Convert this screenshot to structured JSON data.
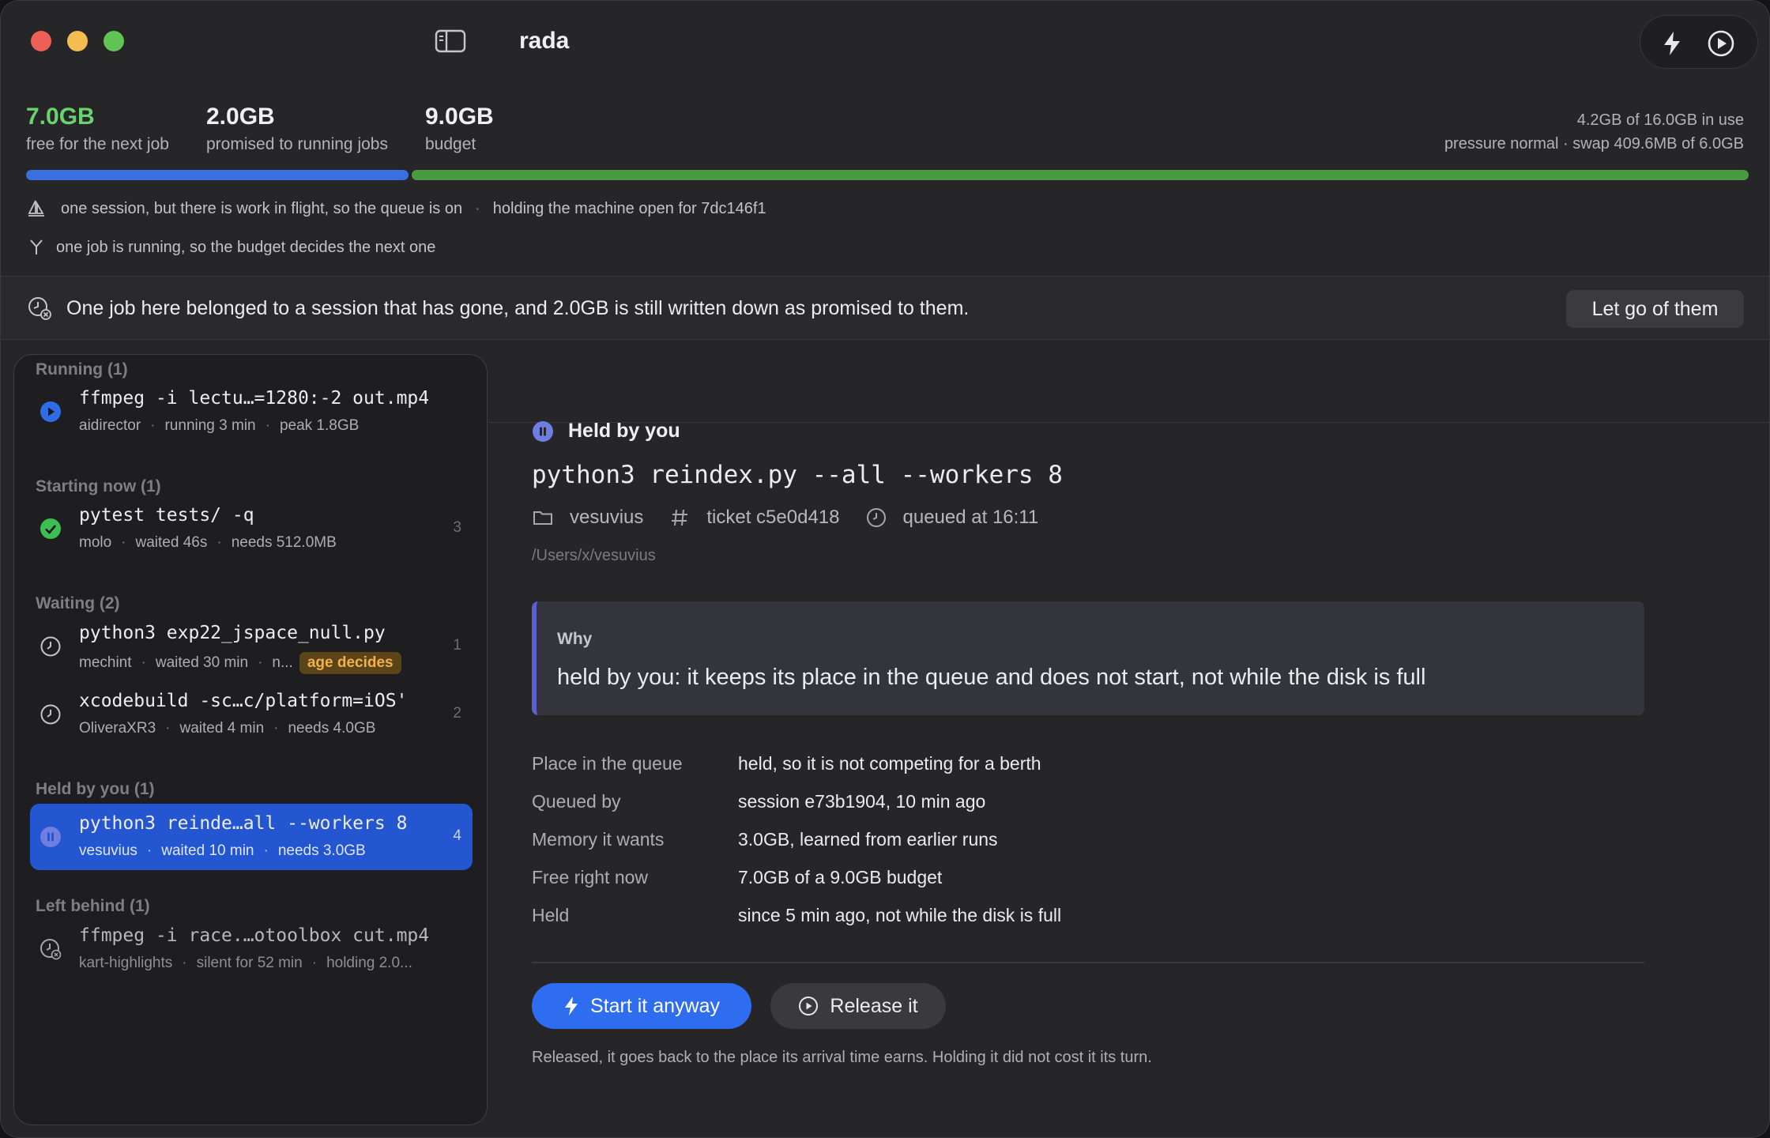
{
  "app": {
    "title": "rada"
  },
  "memory": {
    "free_value": "7.0GB",
    "free_label": "free for the next job",
    "promised_value": "2.0GB",
    "promised_label": "promised to running jobs",
    "budget_value": "9.0GB",
    "budget_label": "budget",
    "in_use": "4.2GB of 16.0GB in use",
    "pressure": "pressure normal · swap 409.6MB of 6.0GB",
    "bar_colors": {
      "promised": "#3a6fe0",
      "free": "#4a9a42"
    }
  },
  "info": {
    "queue_status": "one session, but there is work in flight, so the queue is on",
    "holding": "holding the machine open for 7dc146f1",
    "budget_rule": "one job is running, so the budget decides the next one"
  },
  "alert": {
    "text": "One job here belonged to a session that has gone, and 2.0GB is still written down as promised to them.",
    "button": "Let go of them"
  },
  "sidebar": {
    "groups": {
      "running": "Running (1)",
      "starting": "Starting now (1)",
      "waiting": "Waiting (2)",
      "held": "Held by you (1)",
      "left": "Left behind (1)"
    },
    "jobs": [
      {
        "cmd": "ffmpeg -i lectu…=1280:-2 out.mp4",
        "owner": "aidirector",
        "time": "running 3 min",
        "mem": "peak 1.8GB",
        "num": "",
        "icon": "play-circle-icon"
      },
      {
        "cmd": "pytest tests/ -q",
        "owner": "molo",
        "time": "waited 46s",
        "mem": "needs 512.0MB",
        "num": "3",
        "icon": "check-circle-icon"
      },
      {
        "cmd": "python3 exp22_jspace_null.py",
        "owner": "mechint",
        "time": "waited 30 min",
        "mem": "n...",
        "badge": "age decides",
        "num": "1",
        "icon": "clock-icon"
      },
      {
        "cmd": "xcodebuild -sc…c/platform=iOS'",
        "owner": "OliveraXR3",
        "time": "waited 4 min",
        "mem": "needs 4.0GB",
        "num": "2",
        "icon": "clock-icon"
      },
      {
        "cmd": "python3 reinde…all --workers 8",
        "owner": "vesuvius",
        "time": "waited 10 min",
        "mem": "needs 3.0GB",
        "num": "4",
        "icon": "pause-circle-icon"
      },
      {
        "cmd": "ffmpeg -i race.…otoolbox cut.mp4",
        "owner": "kart-highlights",
        "time": "silent for 52 min",
        "mem": "holding 2.0...",
        "num": "",
        "icon": "clock-x-icon"
      }
    ]
  },
  "detail": {
    "status": "Held by you",
    "command": "python3 reindex.py --all --workers 8",
    "project": "vesuvius",
    "ticket": "ticket c5e0d418",
    "queued": "queued at 16:11",
    "path": "/Users/x/vesuvius",
    "why_title": "Why",
    "why_text": "held by you: it keeps its place in the queue and does not start, not while the disk is full",
    "fields": [
      {
        "key": "Place in the queue",
        "value": "held, so it is not competing for a berth"
      },
      {
        "key": "Queued by",
        "value": "session e73b1904, 10 min ago"
      },
      {
        "key": "Memory it wants",
        "value": "3.0GB, learned from earlier runs"
      },
      {
        "key": "Free right now",
        "value": "7.0GB of a 9.0GB budget"
      },
      {
        "key": "Held",
        "value": "since 5 min ago, not while the disk is full"
      }
    ],
    "start_button": "Start it anyway",
    "release_button": "Release it",
    "footnote": "Released, it goes back to the place its arrival time earns. Holding it did not cost it its turn."
  }
}
